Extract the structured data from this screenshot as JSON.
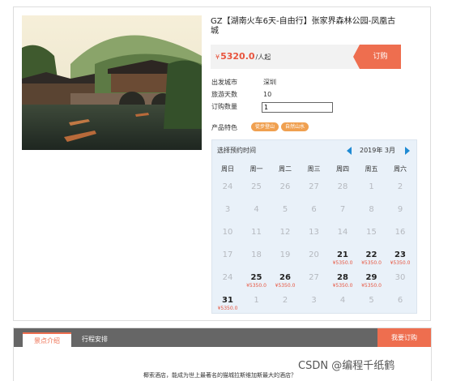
{
  "product": {
    "title": "GZ【湖南火车6天-自由行】张家界森林公园-凤凰古城",
    "price_symbol": "¥",
    "price": "5320.0",
    "price_unit": "/人起",
    "order_label": "订购"
  },
  "info": {
    "depart_label": "出发城市",
    "depart_value": "深圳",
    "days_label": "旅游天数",
    "days_value": "10",
    "qty_label": "订购数量",
    "qty_value": "1",
    "feature_label": "产品特色",
    "tags": [
      "徒步登山",
      "自然山水"
    ]
  },
  "calendar": {
    "heading": "选择预约时间",
    "month_label": "2019年 3月",
    "weekdays": [
      "周日",
      "周一",
      "周二",
      "周三",
      "周四",
      "周五",
      "周六"
    ],
    "rows": [
      [
        {
          "d": "24"
        },
        {
          "d": "25"
        },
        {
          "d": "26"
        },
        {
          "d": "27"
        },
        {
          "d": "28"
        },
        {
          "d": "1"
        },
        {
          "d": "2"
        }
      ],
      [
        {
          "d": "3"
        },
        {
          "d": "4"
        },
        {
          "d": "5"
        },
        {
          "d": "6"
        },
        {
          "d": "7"
        },
        {
          "d": "8"
        },
        {
          "d": "9"
        }
      ],
      [
        {
          "d": "10"
        },
        {
          "d": "11"
        },
        {
          "d": "12"
        },
        {
          "d": "13"
        },
        {
          "d": "14"
        },
        {
          "d": "15"
        },
        {
          "d": "16"
        }
      ],
      [
        {
          "d": "17"
        },
        {
          "d": "18"
        },
        {
          "d": "19"
        },
        {
          "d": "20"
        },
        {
          "d": "21",
          "p": "¥5350.0"
        },
        {
          "d": "22",
          "p": "¥5350.0"
        },
        {
          "d": "23",
          "p": "¥5350.0"
        }
      ],
      [
        {
          "d": "24"
        },
        {
          "d": "25",
          "p": "¥5350.0"
        },
        {
          "d": "26",
          "p": "¥5350.0"
        },
        {
          "d": "27"
        },
        {
          "d": "28",
          "p": "¥5350.0"
        },
        {
          "d": "29",
          "p": "¥5350.0"
        },
        {
          "d": "30"
        }
      ],
      [
        {
          "d": "31",
          "p": "¥5350.0"
        },
        {
          "d": "1"
        },
        {
          "d": "2"
        },
        {
          "d": "3"
        },
        {
          "d": "4"
        },
        {
          "d": "5"
        },
        {
          "d": "6"
        }
      ]
    ]
  },
  "tabs": {
    "tab1": "景点介绍",
    "tab2": "行程安排",
    "book": "我要订购"
  },
  "intro_text": "椰索酒店，能成为世上最著名的猫城拉斯维加斯最大的酒店？",
  "watermark": "CSDN @编程千纸鹤"
}
